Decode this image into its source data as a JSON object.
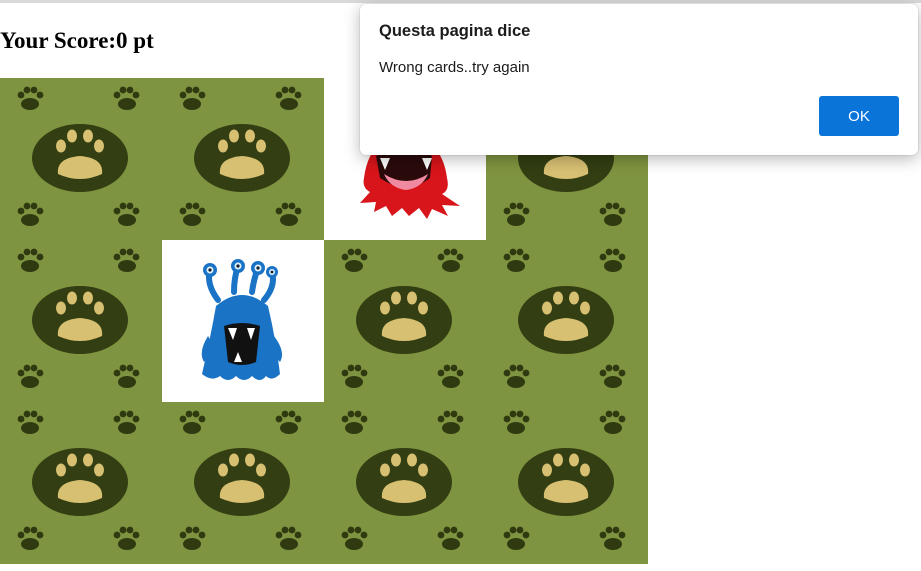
{
  "game": {
    "score_text": "Your Score:0 pt",
    "card_back_color": "#7f9440",
    "cards": [
      {
        "state": "back",
        "monster": ""
      },
      {
        "state": "back",
        "monster": ""
      },
      {
        "state": "face-up",
        "monster": "red-monster-icon"
      },
      {
        "state": "back",
        "monster": ""
      },
      {
        "state": "back",
        "monster": ""
      },
      {
        "state": "face-up",
        "monster": "blue-monster-icon"
      },
      {
        "state": "back",
        "monster": ""
      },
      {
        "state": "back",
        "monster": ""
      },
      {
        "state": "back",
        "monster": ""
      },
      {
        "state": "back",
        "monster": ""
      },
      {
        "state": "back",
        "monster": ""
      },
      {
        "state": "back",
        "monster": ""
      }
    ]
  },
  "dialog": {
    "title": "Questa pagina dice",
    "message": "Wrong cards..try again",
    "ok_label": "OK",
    "ok_color": "#0a74d8"
  }
}
